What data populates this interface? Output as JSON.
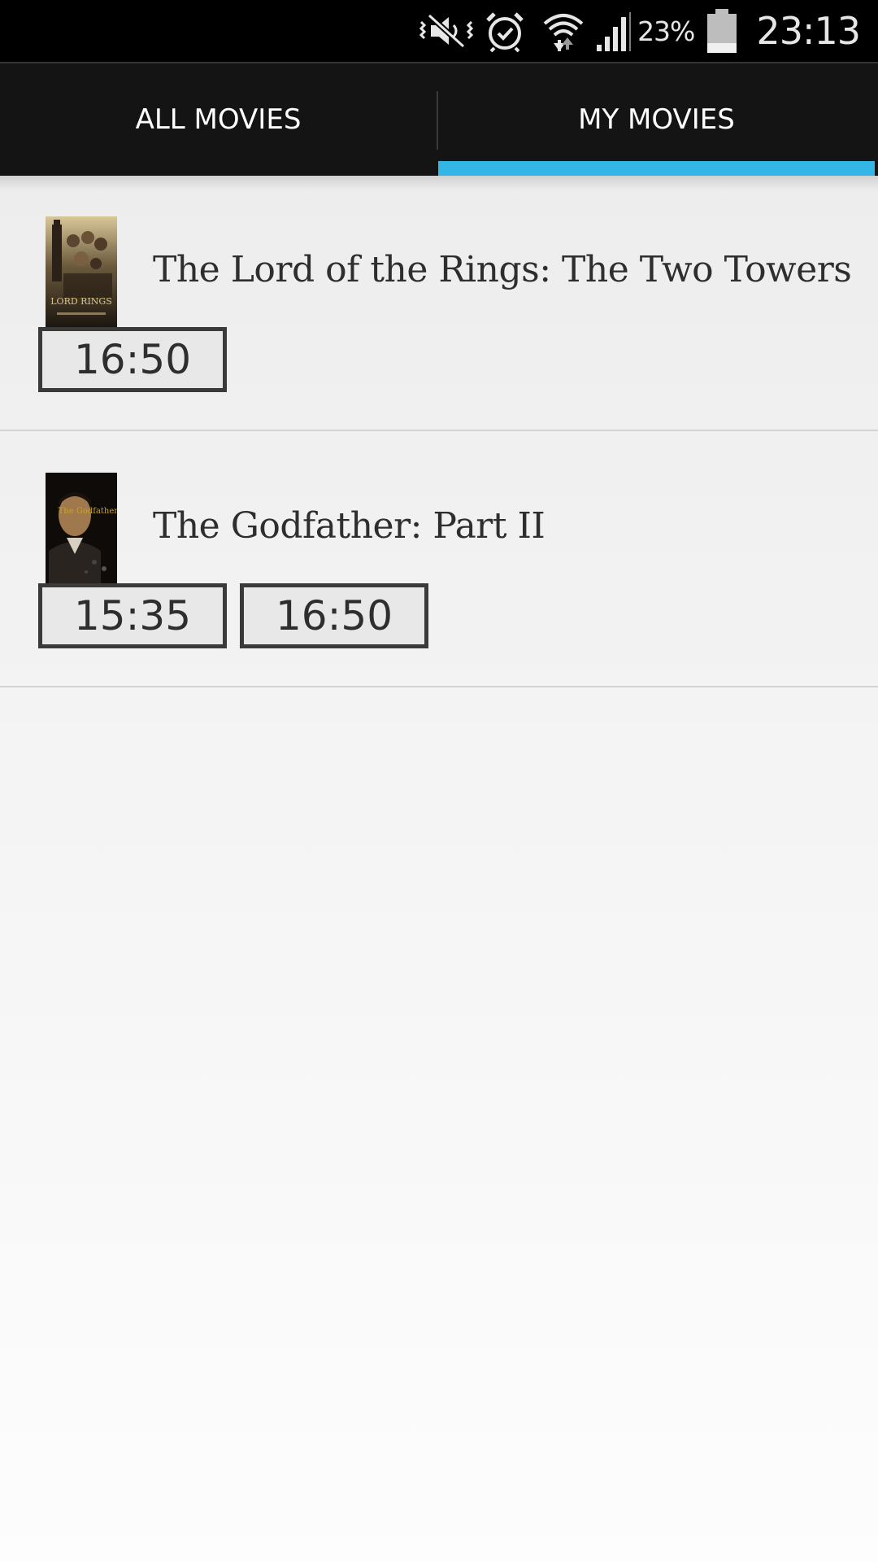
{
  "status_bar": {
    "battery_percent": "23%",
    "time": "23:13",
    "icons": [
      "mute-vibrate-icon",
      "alarm-icon",
      "wifi-icon",
      "cell-signal-icon",
      "battery-icon"
    ]
  },
  "tabs": [
    {
      "label": "ALL MOVIES",
      "selected": false
    },
    {
      "label": "MY MOVIES",
      "selected": true
    }
  ],
  "accent_color": "#33b5e5",
  "movies": [
    {
      "title": "The Lord of the Rings: The Two Towers",
      "poster_text": "LORD RINGS",
      "showtimes": [
        "16:50"
      ]
    },
    {
      "title": "The Godfather: Part II",
      "poster_text": "The Godfather Part II",
      "showtimes": [
        "15:35",
        "16:50"
      ]
    }
  ]
}
